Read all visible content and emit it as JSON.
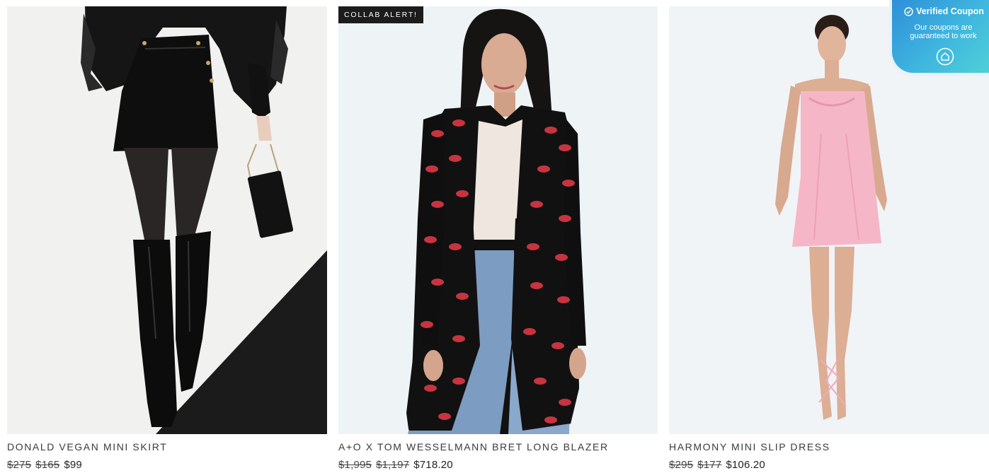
{
  "coupon": {
    "title": "Verified Coupon",
    "subtitle_line1": "Our coupons are",
    "subtitle_line2": "guaranteed to work"
  },
  "colors": {
    "text": "#222222",
    "badge_bg": "#1c1c1c",
    "coupon_gradient_start": "#2e8fd9",
    "coupon_gradient_end": "#4fd0d8"
  },
  "products": [
    {
      "name": "DONALD VEGAN MINI SKIRT",
      "price_original": "$275",
      "price_previous": "$165",
      "price_sale": "$99",
      "image_desc": "model in black feather jacket, vegan leather mini skirt, tall black boots"
    },
    {
      "name": "A+O X TOM WESSELMANN BRET LONG BLAZER",
      "badge": "COLLAB ALERT!",
      "price_original": "$1,995",
      "price_previous": "$1,197",
      "price_sale": "$718.20",
      "image_desc": "model in long black blazer with red lips print and jeans"
    },
    {
      "name": "HARMONY MINI SLIP DRESS",
      "price_original": "$295",
      "price_previous": "$177",
      "price_sale": "$106.20",
      "image_desc": "model in pink satin mini slip dress"
    }
  ]
}
